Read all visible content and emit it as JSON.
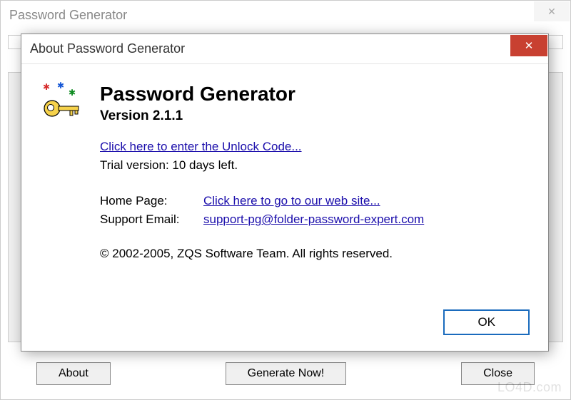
{
  "main_window": {
    "title": "Password Generator",
    "close_glyph": "✕",
    "buttons": {
      "about": "About",
      "generate": "Generate Now!",
      "close": "Close"
    }
  },
  "about_dialog": {
    "title": "About Password Generator",
    "close_glyph": "✕",
    "app_name": "Password Generator",
    "version": "Version 2.1.1",
    "unlock_link": "Click here to enter the Unlock Code...",
    "trial_text": "Trial version: 10 days left.",
    "homepage_label": "Home Page:",
    "homepage_link": "Click here to go to our web site...",
    "support_label": "Support Email:",
    "support_link": "support-pg@folder-password-expert.com",
    "copyright": "© 2002-2005, ZQS Software Team. All rights reserved.",
    "ok_label": "OK"
  },
  "watermark": "LO4D.com"
}
